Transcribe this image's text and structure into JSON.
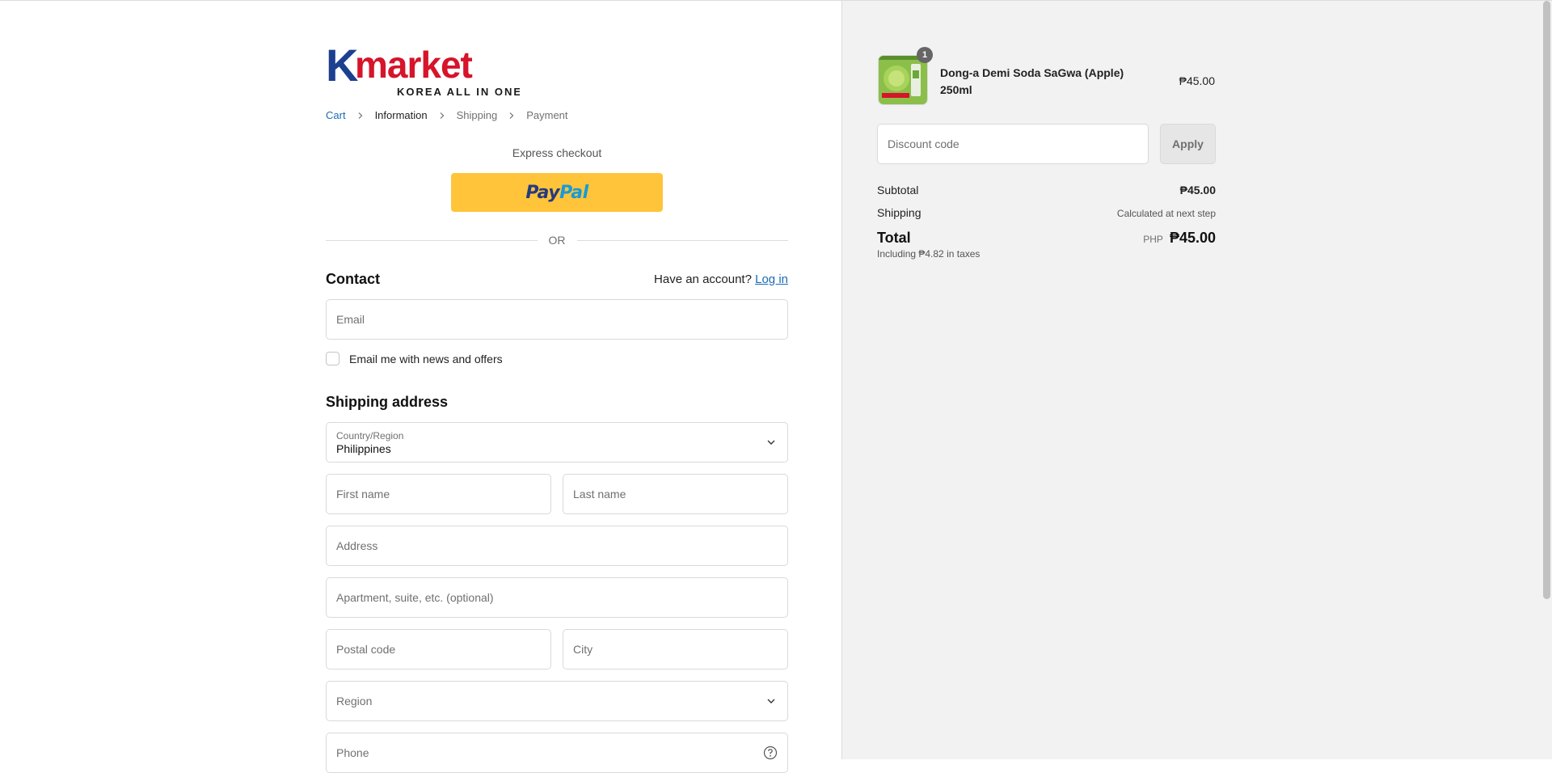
{
  "brand": {
    "name": "Kmarket",
    "tagline": "KOREA ALL IN ONE",
    "color_blue": "#1d3f8f",
    "color_red": "#d6142a"
  },
  "breadcrumb": {
    "cart": "Cart",
    "information": "Information",
    "shipping": "Shipping",
    "payment": "Payment"
  },
  "express": {
    "title": "Express checkout",
    "paypal_part1": "Pay",
    "paypal_part2": "Pal",
    "or": "OR"
  },
  "contact": {
    "heading": "Contact",
    "have_account": "Have an account?",
    "login": "Log in",
    "email_placeholder": "Email",
    "news_label": "Email me with news and offers"
  },
  "shipping": {
    "heading": "Shipping address",
    "country_label": "Country/Region",
    "country_value": "Philippines",
    "first_name": "First name",
    "last_name": "Last name",
    "address": "Address",
    "apartment": "Apartment, suite, etc. (optional)",
    "postal": "Postal code",
    "city": "City",
    "region": "Region",
    "phone": "Phone"
  },
  "summary": {
    "item": {
      "name": "Dong-a Demi Soda SaGwa (Apple) 250ml",
      "price": "₱45.00",
      "qty": "1"
    },
    "discount_placeholder": "Discount code",
    "apply": "Apply",
    "subtotal_label": "Subtotal",
    "subtotal_value": "₱45.00",
    "shipping_label": "Shipping",
    "shipping_value": "Calculated at next step",
    "total_label": "Total",
    "currency": "PHP",
    "total_value": "₱45.00",
    "tax_note": "Including ₱4.82 in taxes"
  }
}
